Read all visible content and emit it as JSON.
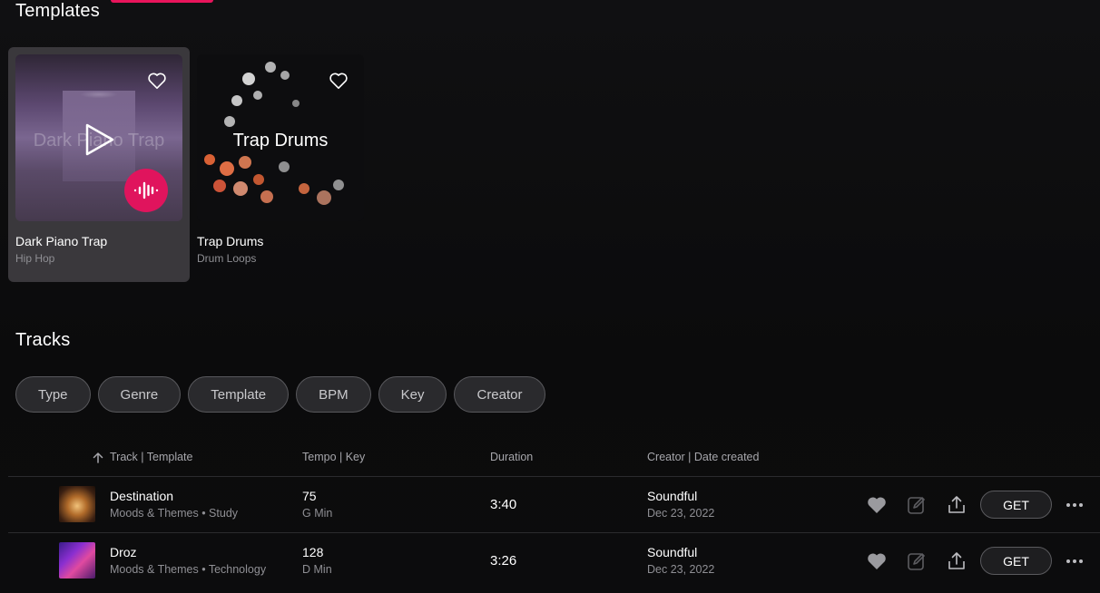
{
  "sections": {
    "templates_title": "Templates",
    "tracks_title": "Tracks"
  },
  "templates": [
    {
      "name": "Dark Piano Trap",
      "genre": "Hip Hop",
      "overlay": "Dark Piano Trap"
    },
    {
      "name": "Trap Drums",
      "genre": "Drum Loops",
      "overlay": "Trap Drums"
    }
  ],
  "filters": [
    "Type",
    "Genre",
    "Template",
    "BPM",
    "Key",
    "Creator"
  ],
  "table": {
    "headers": {
      "track": "Track | Template",
      "tempo": "Tempo | Key",
      "duration": "Duration",
      "creator": "Creator | Date created"
    },
    "rows": [
      {
        "title": "Destination",
        "subtitle": "Moods & Themes • Study",
        "tempo": "75",
        "key": "G Min",
        "duration": "3:40",
        "creator": "Soundful",
        "date": "Dec 23, 2022",
        "get_label": "GET"
      },
      {
        "title": "Droz",
        "subtitle": "Moods & Themes • Technology",
        "tempo": "128",
        "key": "D Min",
        "duration": "3:26",
        "creator": "Soundful",
        "date": "Dec 23, 2022",
        "get_label": "GET"
      }
    ]
  },
  "colors": {
    "accent": "#e0145d",
    "background": "#0c0c0d"
  },
  "icons": [
    "heart-outline-icon",
    "play-icon",
    "waveform-icon",
    "sort-arrow-up-icon",
    "heart-filled-icon",
    "edit-icon",
    "share-icon",
    "more-horizontal-icon"
  ]
}
